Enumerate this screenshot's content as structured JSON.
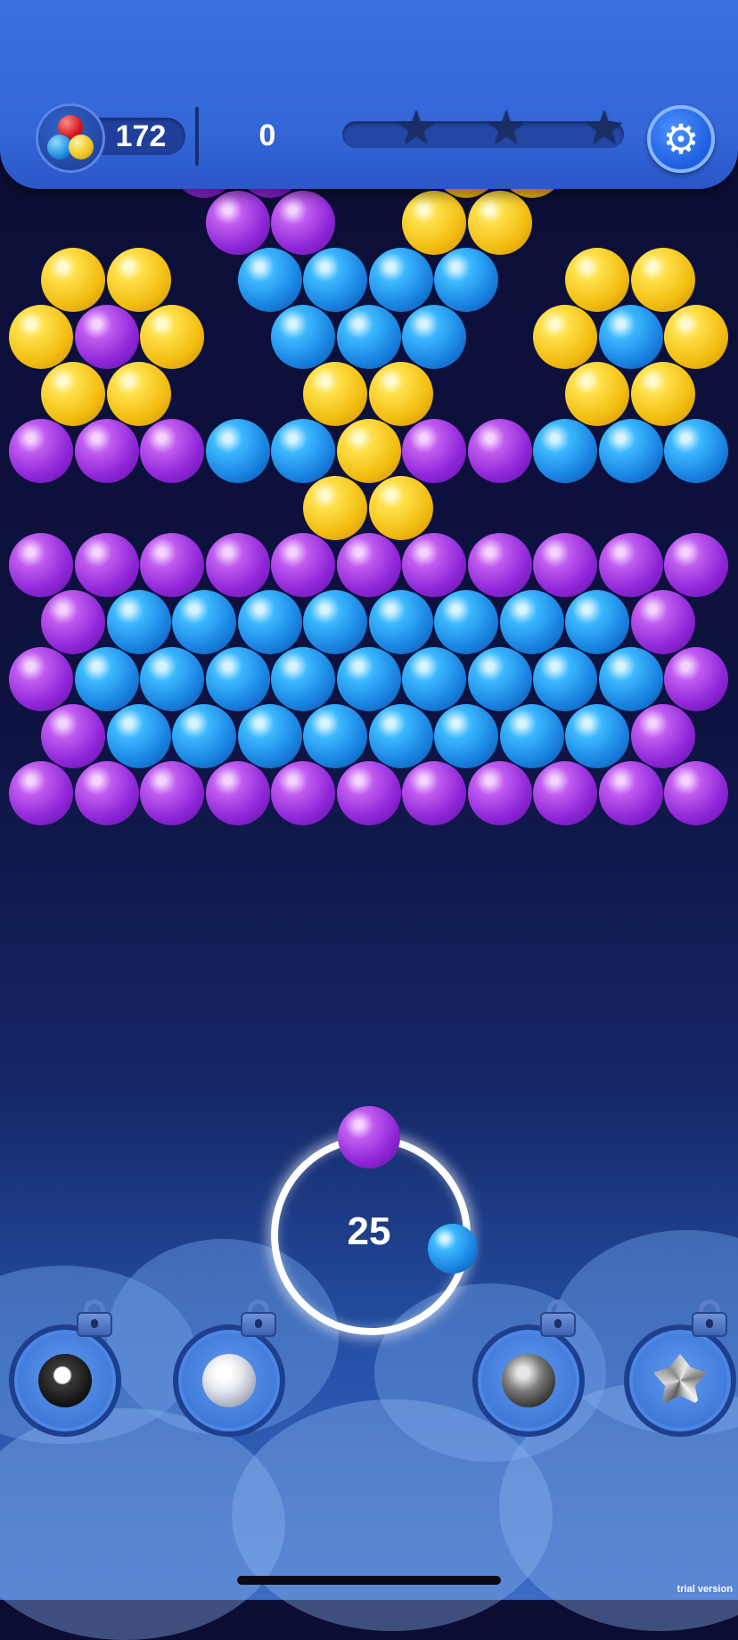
{
  "header": {
    "coins": "172",
    "score": "0",
    "stars_earned": 0,
    "stars_total": 3,
    "progress": 0
  },
  "game": {
    "moves_left": "25",
    "current_ball_color": "purple",
    "next_ball_color": "blue",
    "colors": {
      "yellow": "#f2bd10",
      "purple": "#8e26d8",
      "blue": "#1a84e2"
    }
  },
  "boosters": [
    {
      "name": "skull-bomb",
      "icon": "skull-bomb-icon",
      "locked": true
    },
    {
      "name": "potion",
      "icon": "potion-icon",
      "locked": true
    },
    {
      "name": "bomb",
      "icon": "bomb-icon",
      "locked": true
    },
    {
      "name": "crystal",
      "icon": "crystal-icon",
      "locked": true
    }
  ],
  "watermark": "trial version"
}
